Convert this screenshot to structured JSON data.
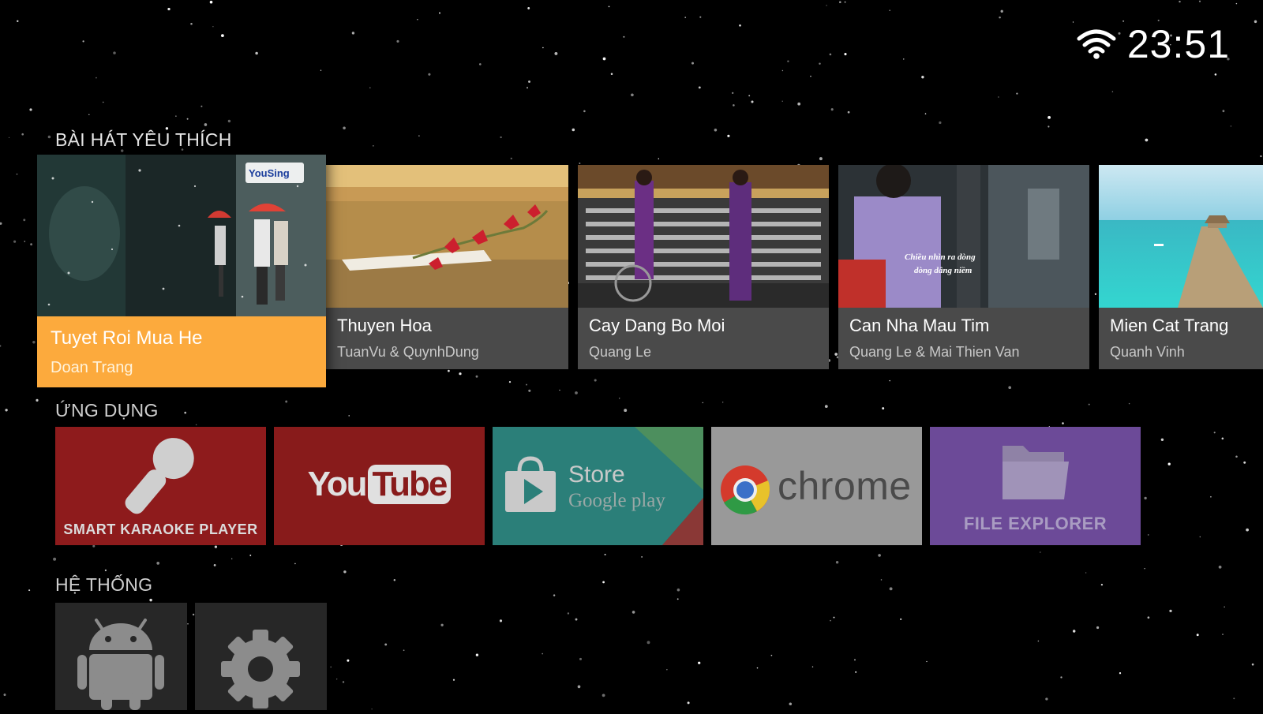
{
  "status": {
    "time": "23:51",
    "wifi_icon": "wifi-icon"
  },
  "favorites": {
    "title": "BÀI HÁT YÊU THÍCH",
    "items": [
      {
        "title": "Tuyet Roi Mua He",
        "artist": "Doan Trang",
        "logo": "YouSing",
        "focused": true
      },
      {
        "title": "Thuyen Hoa",
        "artist": "TuanVu & QuynhDung"
      },
      {
        "title": "Cay Dang Bo Moi",
        "artist": "Quang Le"
      },
      {
        "title": "Can Nha Mau Tim",
        "artist": "Quang Le & Mai Thien Van",
        "caption_line1": "Chiều nhìn ra dòng",
        "caption_line2": "dòng dâng niềm"
      },
      {
        "title": "Mien Cat Trang",
        "artist": "Quanh Vinh"
      }
    ]
  },
  "apps": {
    "title": "ỨNG DỤNG",
    "items": [
      {
        "label": "SMART KARAOKE PLAYER",
        "icon": "microphone-icon",
        "color": "#8e1b1c"
      },
      {
        "label": "YouTube",
        "logo_you": "You",
        "logo_tube": "Tube",
        "icon": "youtube-logo",
        "color": "#881b1b"
      },
      {
        "label": "Store",
        "sublabel": "Google play",
        "icon": "play-store-icon",
        "color": "#2b7f79"
      },
      {
        "label": "chrome",
        "icon": "chrome-icon",
        "color": "#999999"
      },
      {
        "label": "FILE EXPLORER",
        "icon": "folder-icon",
        "color": "#6c4a98"
      }
    ]
  },
  "system": {
    "title": "HỆ THỐNG",
    "items": [
      {
        "icon": "android-icon"
      },
      {
        "icon": "gear-icon"
      }
    ]
  }
}
